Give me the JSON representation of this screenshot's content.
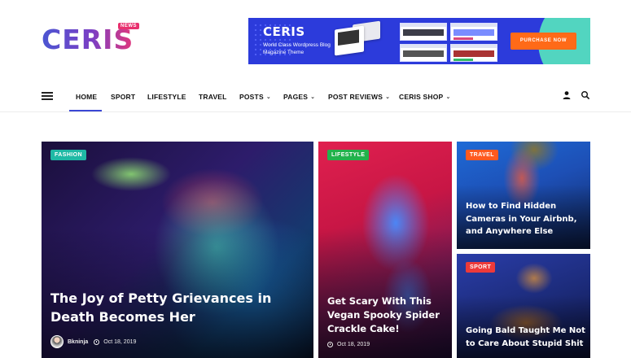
{
  "logo": {
    "text": "CERIS",
    "badge": "NEWS"
  },
  "banner": {
    "title": "CERIS",
    "subtitle": "World Class Wordpress Blog Magazine Theme",
    "cta": "PURCHASE NOW",
    "colors": {
      "background": "#2c3bdb",
      "cta": "#ff6a18",
      "accent": "#54ddbf"
    }
  },
  "nav": {
    "items": [
      {
        "label": "HOME",
        "dropdown": false,
        "active": true
      },
      {
        "label": "SPORT",
        "dropdown": false
      },
      {
        "label": "LIFESTYLE",
        "dropdown": false
      },
      {
        "label": "TRAVEL",
        "dropdown": false
      },
      {
        "label": "POSTS",
        "dropdown": true
      },
      {
        "label": "PAGES",
        "dropdown": true
      },
      {
        "label": "POST REVIEWS",
        "dropdown": true
      },
      {
        "label": "CERIS SHOP",
        "dropdown": true
      }
    ],
    "icons": [
      "menu-icon",
      "user-icon",
      "search-icon"
    ],
    "active_color": "#3a47d5"
  },
  "cards": [
    {
      "category": "FASHION",
      "category_color": "#1fb9a5",
      "title": "The Joy of Petty Grievances in Death Becomes Her",
      "author": "Bkninja",
      "date": "Oct 18, 2019"
    },
    {
      "category": "LIFESTYLE",
      "category_color": "#22b24c",
      "title": "Get Scary With This Vegan Spooky Spider Crackle Cake!",
      "date": "Oct 18, 2019"
    },
    {
      "category": "TRAVEL",
      "category_color": "#ff5a1f",
      "title": "How to Find Hidden Cameras in Your Airbnb, and Anywhere Else"
    },
    {
      "category": "SPORT",
      "category_color": "#ee3a3a",
      "title": "Going Bald Taught Me Not to Care About Stupid Shit"
    }
  ]
}
